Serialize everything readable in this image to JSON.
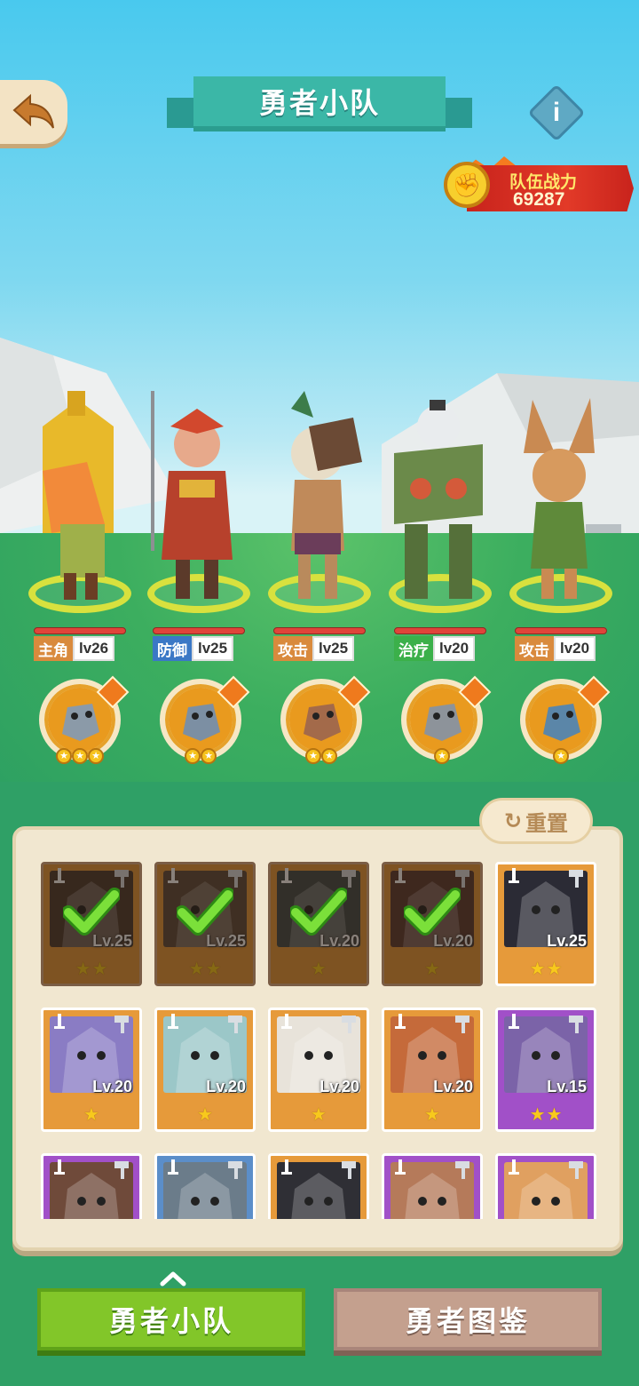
{
  "header": {
    "title": "勇者小队",
    "back_icon": "back-arrow-icon",
    "info_label": "i"
  },
  "team_power": {
    "label": "队伍战力",
    "value": "69287"
  },
  "heroes": [
    {
      "role": "主角",
      "level": "lv26",
      "role_color": "#d98a3d"
    },
    {
      "role": "防御",
      "level": "lv25",
      "role_color": "#3b78c6"
    },
    {
      "role": "攻击",
      "level": "lv25",
      "role_color": "#d98a3d"
    },
    {
      "role": "治疗",
      "level": "lv20",
      "role_color": "#3bb04a"
    },
    {
      "role": "攻击",
      "level": "lv20",
      "role_color": "#d98a3d"
    }
  ],
  "pets": [
    {
      "stars": 3
    },
    {
      "stars": 2
    },
    {
      "stars": 2
    },
    {
      "stars": 1
    },
    {
      "stars": 1
    }
  ],
  "reset_label": "重置",
  "roster": [
    {
      "level": "Lv.25",
      "stars": 2,
      "color": "orange",
      "selected": true
    },
    {
      "level": "Lv.25",
      "stars": 2,
      "color": "orange",
      "selected": true
    },
    {
      "level": "Lv.20",
      "stars": 1,
      "color": "orange",
      "selected": true
    },
    {
      "level": "Lv.20",
      "stars": 1,
      "color": "orange",
      "selected": true
    },
    {
      "level": "Lv.25",
      "stars": 2,
      "color": "orange",
      "selected": false
    },
    {
      "level": "Lv.20",
      "stars": 1,
      "color": "orange",
      "selected": false
    },
    {
      "level": "Lv.20",
      "stars": 1,
      "color": "orange",
      "selected": false
    },
    {
      "level": "Lv.20",
      "stars": 1,
      "color": "orange",
      "selected": false
    },
    {
      "level": "Lv.20",
      "stars": 1,
      "color": "orange",
      "selected": false
    },
    {
      "level": "Lv.15",
      "stars": 2,
      "color": "purple",
      "selected": false
    },
    {
      "level": "",
      "stars": 0,
      "color": "purple",
      "selected": false
    },
    {
      "level": "",
      "stars": 0,
      "color": "blue",
      "selected": false
    },
    {
      "level": "",
      "stars": 0,
      "color": "orange",
      "selected": false
    },
    {
      "level": "",
      "stars": 0,
      "color": "purple",
      "selected": false
    },
    {
      "level": "",
      "stars": 0,
      "color": "purple",
      "selected": false
    }
  ],
  "bottom_tabs": {
    "team": "勇者小队",
    "catalog": "勇者图鉴"
  }
}
